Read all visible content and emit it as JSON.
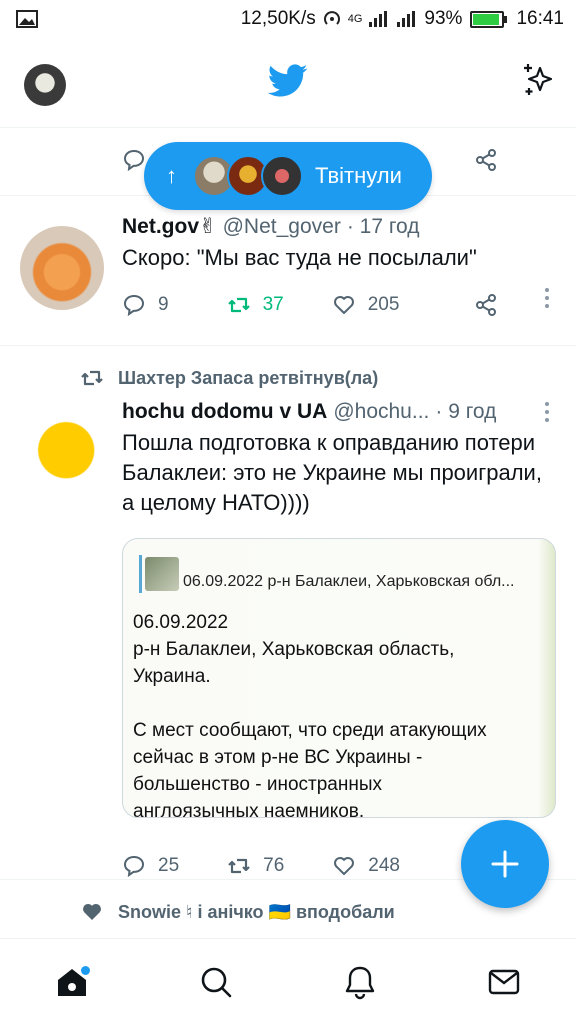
{
  "status_bar": {
    "speed": "12,50K/s",
    "network": "4G",
    "battery": "93%",
    "battery_level": 0.93,
    "time": "16:41"
  },
  "header": {
    "logo_icon": "twitter-bird-icon",
    "accent_color": "#1d9bf0"
  },
  "retweet_bubble": {
    "arrow": "↑",
    "label": "Твітнули"
  },
  "partial_tweet": {
    "reply": "",
    "share_icon": "share-icon"
  },
  "tweets": [
    {
      "name": "Net.gov✌",
      "handle": "@Net_gover",
      "time": "· 17 год",
      "text": "Скоро: \"Мы вас туда не посылали\"",
      "replies": "9",
      "retweets": "37",
      "likes": "205",
      "retweeted_by_me": true
    },
    {
      "retweet_context": "Шахтер Запаса ретвітнув(ла)",
      "name": "hochu dodomu v UA",
      "handle": "@hochu...",
      "time": "· 9 год",
      "text": "Пошла подготовка к оправданию потери Балаклеи: это не Украине мы проиграли, а целому НАТО))))",
      "embed": {
        "quote": "06.09.2022 р-н Балаклеи, Харьковская обл...",
        "body": "06.09.2022\nр-н Балаклеи, Харьковская область,\nУкраина.\n\nС мест сообщают, что среди атакующих\nсейчас в этом р-не ВС Украины -\nбольшенство - иностранных\nанглоязычных наемников."
      },
      "replies": "25",
      "retweets": "76",
      "likes": "248"
    }
  ],
  "liked_context": "Snowie ♮ і анічко 🇺🇦 вподобали",
  "nav": [
    "home-icon",
    "search-icon",
    "notifications-icon",
    "messages-icon"
  ]
}
